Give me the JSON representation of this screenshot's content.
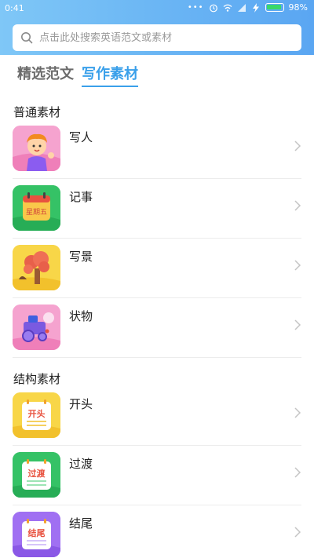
{
  "status_bar": {
    "time": "0:41",
    "battery": "98%"
  },
  "search": {
    "placeholder": "点击此处搜索英语范文或素材"
  },
  "tabs": [
    {
      "label": "精选范文",
      "active": false
    },
    {
      "label": "写作素材",
      "active": true
    }
  ],
  "sections": [
    {
      "title": "普通素材",
      "items": [
        {
          "label": "写人",
          "icon": "person-cartoon-icon",
          "color": "#f7a7d2"
        },
        {
          "label": "记事",
          "icon": "calendar-icon",
          "color": "#2dbf62",
          "icon_text": "星期五"
        },
        {
          "label": "写景",
          "icon": "tree-landscape-icon",
          "color": "#f7d443"
        },
        {
          "label": "状物",
          "icon": "toy-train-icon",
          "color": "#f7a7d2"
        }
      ]
    },
    {
      "title": "结构素材",
      "items": [
        {
          "label": "开头",
          "icon": "notepad-icon",
          "color": "#f7d443",
          "icon_text": "开头"
        },
        {
          "label": "过渡",
          "icon": "notepad-icon",
          "color": "#2dbf62",
          "icon_text": "过渡"
        },
        {
          "label": "结尾",
          "icon": "notepad-icon",
          "color": "#9d6ef0",
          "icon_text": "结尾"
        }
      ]
    }
  ],
  "colors": {
    "accent": "#3aa0ea",
    "header_start": "#7fc7f7",
    "header_end": "#5aa6f2"
  }
}
